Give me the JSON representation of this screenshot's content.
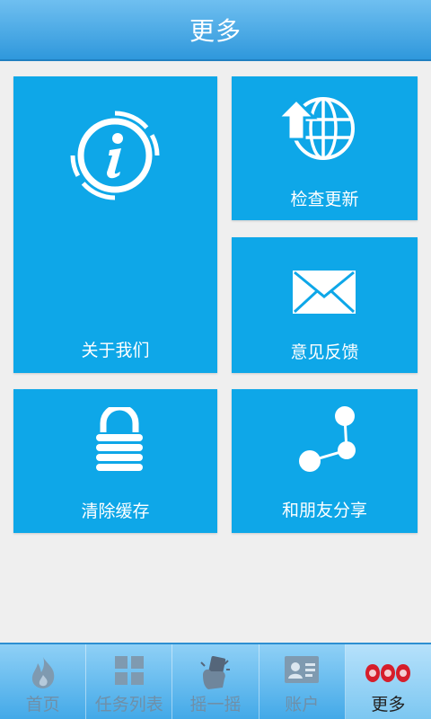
{
  "header": {
    "title": "更多"
  },
  "tiles": {
    "about": {
      "label": "关于我们",
      "icon": "info-icon"
    },
    "update": {
      "label": "检查更新",
      "icon": "upload-globe-icon"
    },
    "feedback": {
      "label": "意见反馈",
      "icon": "mail-icon"
    },
    "cache": {
      "label": "清除缓存",
      "icon": "lock-icon"
    },
    "share": {
      "label": "和朋友分享",
      "icon": "share-icon"
    }
  },
  "tabbar": {
    "items": [
      {
        "label": "首页",
        "icon": "flame-icon"
      },
      {
        "label": "任务列表",
        "icon": "grid-icon"
      },
      {
        "label": "摇一摇",
        "icon": "shake-phone-icon"
      },
      {
        "label": "账户",
        "icon": "contact-card-icon"
      },
      {
        "label": "更多",
        "icon": "more-dots-icon",
        "active": true
      }
    ]
  },
  "colors": {
    "tile": "#0ea7e8",
    "header": "#2f98dc",
    "background": "#efefef",
    "active_icon": "#d61e2b"
  }
}
